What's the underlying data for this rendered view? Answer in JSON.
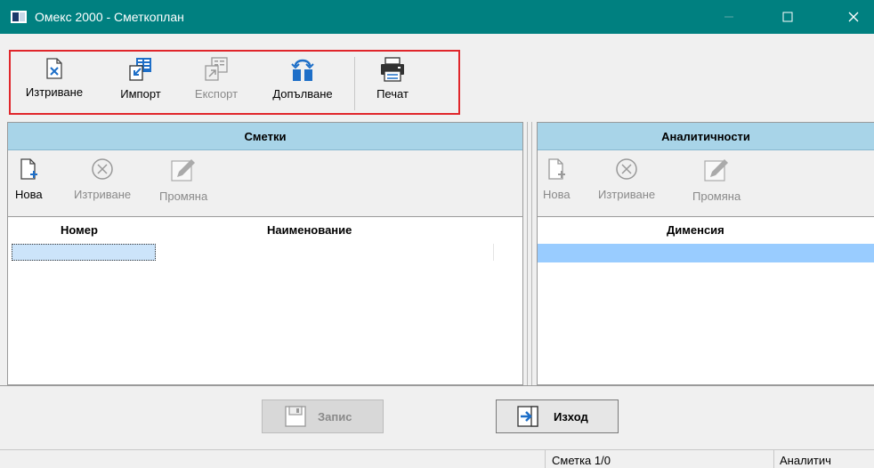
{
  "window": {
    "title": "Омекс 2000 - Сметкоплан",
    "minimize_icon": "minimize-icon",
    "maximize_icon": "maximize-icon",
    "close_icon": "close-icon",
    "title_bar_color": "#008080"
  },
  "toolbar": {
    "delete_label": "Изтриване",
    "import_label": "Импорт",
    "export_label": "Експорт",
    "append_label": "Допълване",
    "print_label": "Печат",
    "export_enabled": false,
    "highlight_color": "#e0262b"
  },
  "accounts_pane": {
    "header": "Сметки",
    "new_label": "Нова",
    "delete_label": "Изтриване",
    "edit_label": "Промяна",
    "columns": [
      "Номер",
      "Наименование"
    ],
    "header_color": "#a8d4e8"
  },
  "analytics_pane": {
    "header": "Аналитичности",
    "new_label": "Нова",
    "delete_label": "Изтриване",
    "edit_label": "Промяна",
    "columns": [
      "Дименсия"
    ],
    "selected_row_color": "#99ccff"
  },
  "buttons": {
    "save_label": "Запис",
    "exit_label": "Изход",
    "save_enabled": false
  },
  "status": {
    "account_count": "Сметка 1/0",
    "analytics_count": "Аналитич"
  }
}
